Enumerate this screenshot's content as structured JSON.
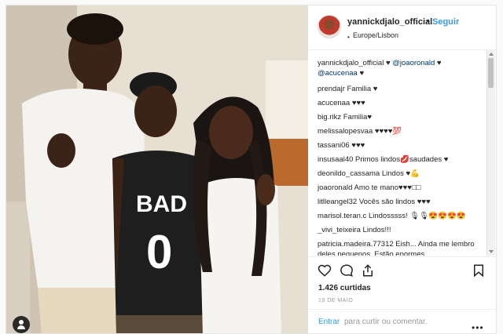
{
  "post": {
    "username": "yannickdjalo_official",
    "follow_label": "Seguir",
    "location": "Europe/Lisbon",
    "separator": "•",
    "location_dot": "•"
  },
  "comments": [
    {
      "user": "yannickdjalo_official",
      "text": " ♥ ",
      "mention1": "@joaoronald",
      "text2": " ♥ ",
      "mention2": "@acucenaa",
      "text3": " ♥"
    },
    {
      "user": "prendajr",
      "text": " Familia ♥"
    },
    {
      "user": "acucenaa",
      "text": " ♥♥♥"
    },
    {
      "user": "big.rikz",
      "text": " Familia♥"
    },
    {
      "user": "melissalopesvaa",
      "text": " ♥♥♥♥💯"
    },
    {
      "user": "tassani06",
      "text": " ♥♥♥"
    },
    {
      "user": "insusaal40",
      "text": " Primos lindos💋saudades ♥"
    },
    {
      "user": "deonildo_cassama",
      "text": " Lindos ♥💪"
    },
    {
      "user": "joaoronald",
      "text": " Amo te mano♥♥♥□□"
    },
    {
      "user": "litlleangel32",
      "text": " Vocês são lindos ♥♥♥"
    },
    {
      "user": "marisol.teran.c",
      "text": " Lindosssss! 🎙🎙😍😍😍😍"
    },
    {
      "user": "_vivi_teixeira",
      "text": " Lindos!!!"
    },
    {
      "user": "patricia.madeira.77312",
      "text": " Eish... Ainda me lembro deles pequenos. Estão enormes."
    }
  ],
  "footer": {
    "likes": "1.426 curtidas",
    "date": "19 DE MAIO",
    "enter_label": "Entrar",
    "enter_rest": "para curtir ou comentar.",
    "more": "•••"
  },
  "icons": {
    "like": "heart-icon",
    "comment": "comment-icon",
    "share": "share-icon",
    "save": "bookmark-icon",
    "tag": "user-tag-icon"
  },
  "photo_text": {
    "shirt_top": "BAD",
    "shirt_number": "0"
  },
  "colors": {
    "link": "#3897f0",
    "text": "#262626",
    "muted": "#999999"
  }
}
